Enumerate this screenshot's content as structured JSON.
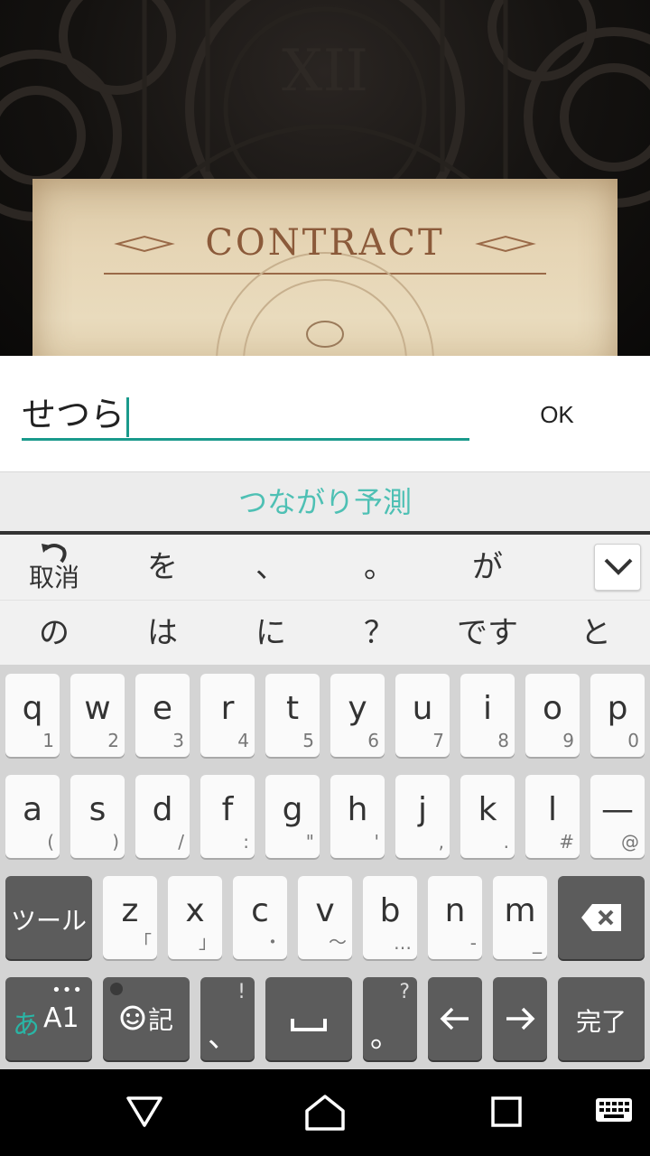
{
  "game": {
    "title": "CONTRACT",
    "numeral": "XII"
  },
  "dialog": {
    "input_value": "せつら",
    "ok_label": "OK"
  },
  "prediction": {
    "label": "つながり予測"
  },
  "candidates": {
    "undo_label": "取消",
    "row1": [
      "を",
      "、",
      "。",
      "が"
    ],
    "row2": [
      "の",
      "は",
      "に",
      "？",
      "です",
      "と"
    ]
  },
  "keyboard": {
    "row1": [
      {
        "main": "q",
        "sub": "1"
      },
      {
        "main": "w",
        "sub": "2"
      },
      {
        "main": "e",
        "sub": "3"
      },
      {
        "main": "r",
        "sub": "4"
      },
      {
        "main": "t",
        "sub": "5"
      },
      {
        "main": "y",
        "sub": "6"
      },
      {
        "main": "u",
        "sub": "7"
      },
      {
        "main": "i",
        "sub": "8"
      },
      {
        "main": "o",
        "sub": "9"
      },
      {
        "main": "p",
        "sub": "0"
      }
    ],
    "row2": [
      {
        "main": "a",
        "sub": "("
      },
      {
        "main": "s",
        "sub": ")"
      },
      {
        "main": "d",
        "sub": "/"
      },
      {
        "main": "f",
        "sub": ":"
      },
      {
        "main": "g",
        "sub": "\""
      },
      {
        "main": "h",
        "sub": "'"
      },
      {
        "main": "j",
        "sub": ","
      },
      {
        "main": "k",
        "sub": "."
      },
      {
        "main": "l",
        "sub": "#"
      },
      {
        "main": "—",
        "sub": "@"
      }
    ],
    "row3": [
      {
        "main": "z",
        "sub": "「"
      },
      {
        "main": "x",
        "sub": "」"
      },
      {
        "main": "c",
        "sub": "・"
      },
      {
        "main": "v",
        "sub": "〜"
      },
      {
        "main": "b",
        "sub": "…"
      },
      {
        "main": "n",
        "sub": "-"
      },
      {
        "main": "m",
        "sub": "_"
      }
    ],
    "tool_label": "ツール",
    "mode_hira": "あ",
    "mode_alpha": "A1",
    "emoji_label": "記",
    "comma": "、",
    "comma_sub": "!",
    "period": "。",
    "period_sub": "?",
    "done_label": "完了"
  },
  "colors": {
    "accent": "#1a9a8c",
    "prediction_text": "#4ec0b4",
    "key_dark": "#5c5c5c"
  },
  "icons": {
    "undo": "undo-arrow-icon",
    "collapse": "chevron-down-icon",
    "backspace": "backspace-icon",
    "space": "space-bar-icon",
    "left": "arrow-left-icon",
    "right": "arrow-right-icon",
    "nav_back": "triangle-back-icon",
    "nav_home": "home-icon",
    "nav_recents": "square-recents-icon",
    "nav_keyboard": "keyboard-icon"
  }
}
